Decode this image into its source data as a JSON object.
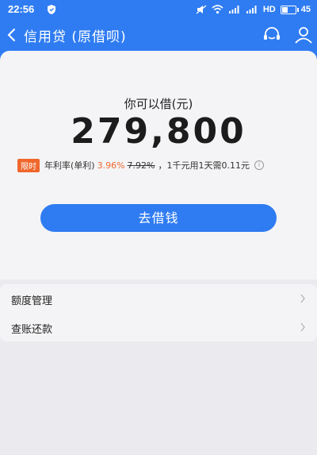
{
  "status_bar": {
    "time": "22:56",
    "network": "HD",
    "battery": "45"
  },
  "nav": {
    "title": "信用贷 (原借呗)"
  },
  "loan": {
    "label": "你可以借(元)",
    "amount": "279,800",
    "badge": "限时",
    "rate_prefix": "年利率(单利)",
    "rate_new": "3.96%",
    "rate_old": "7.92%",
    "rate_suffix": "，1千元用1天需0.11元",
    "button": "去借钱"
  },
  "menu": {
    "items": [
      {
        "label": "额度管理"
      },
      {
        "label": "查账还款"
      }
    ]
  },
  "colors": {
    "brand": "#2f7cf2",
    "accent": "#f0672c",
    "background": "#ebebef"
  }
}
